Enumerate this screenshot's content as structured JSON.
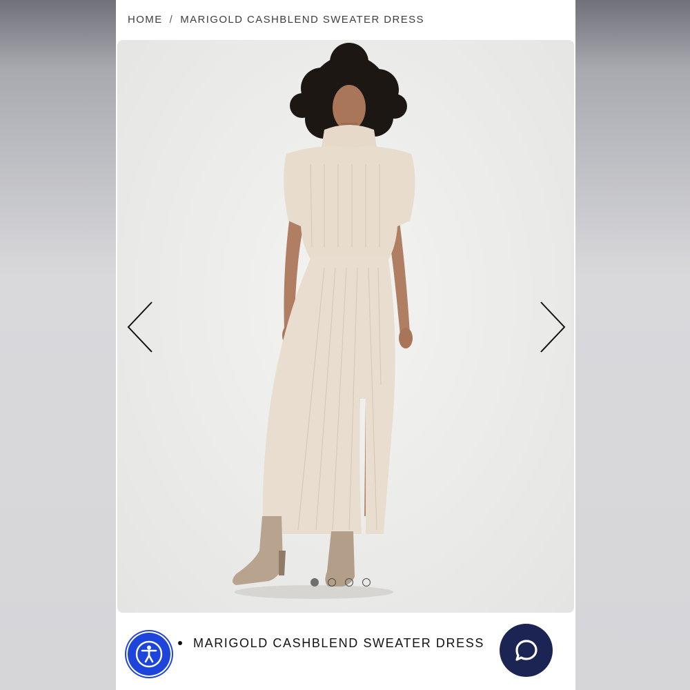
{
  "breadcrumb": {
    "home": "HOME",
    "separator": "/",
    "current": "MARIGOLD CASHBLEND SWEATER DRESS"
  },
  "gallery": {
    "image_alt": "Model wearing cream ribbed turtleneck sweater dress with side slit and tan suede boots",
    "prev_icon": "chevron-left-icon",
    "next_icon": "chevron-right-icon",
    "slide_count": 4,
    "active_slide": 1
  },
  "product": {
    "title": "MARIGOLD CASHBLEND SWEATER DRESS"
  },
  "widgets": {
    "accessibility_icon": "accessibility-icon",
    "chat_icon": "chat-bubble-icon"
  },
  "colors": {
    "accessibility_blue": "#1d45dc",
    "chat_navy": "#1b2452",
    "dress_cream": "#e8dccd",
    "boot_tan": "#b8a38e"
  }
}
